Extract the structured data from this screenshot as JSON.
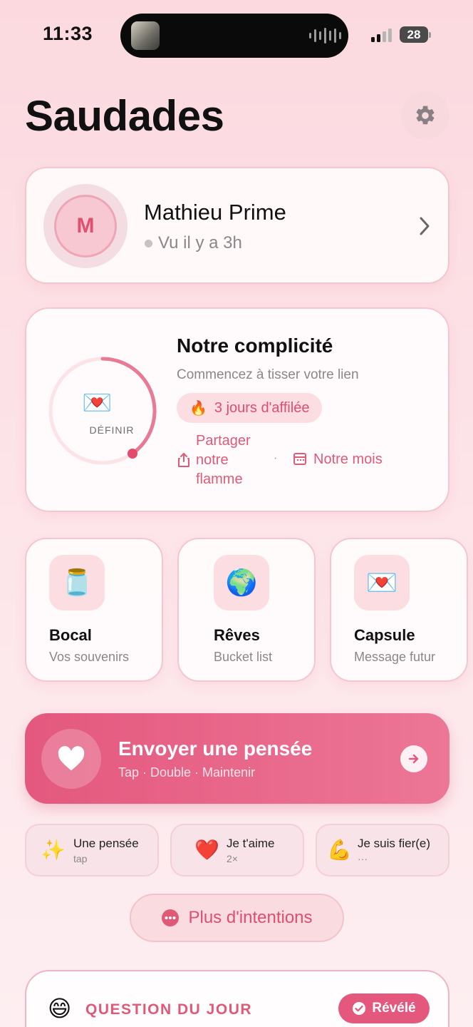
{
  "status_bar": {
    "time": "11:33",
    "battery": "28"
  },
  "header": {
    "title": "Saudades",
    "settings_icon": "gear-icon"
  },
  "profile": {
    "initial": "M",
    "name": "Mathieu Prime",
    "last_seen": "Vu il y a 3h"
  },
  "complicity": {
    "ring_label": "DÉFINIR",
    "ring_icon": "💌",
    "title": "Notre complicité",
    "subtitle": "Commencez à tisser votre lien",
    "streak_icon": "🔥",
    "streak": "3 jours d'affilée",
    "share": "Partager notre flamme",
    "separator": "·",
    "month": "Notre mois",
    "accent": "#e0597a"
  },
  "tiles": [
    {
      "icon": "🫙",
      "name": "Bocal",
      "sub": "Vos souvenirs"
    },
    {
      "icon": "🌍",
      "name": "Rêves",
      "sub": "Bucket list"
    },
    {
      "icon": "💌",
      "name": "Capsule",
      "sub": "Message futur"
    }
  ],
  "send": {
    "title": "Envoyer une pensée",
    "subtitle": "Tap · Double · Maintenir"
  },
  "chips": [
    {
      "icon": "✨",
      "title": "Une pensée",
      "sub": "tap"
    },
    {
      "icon": "❤️",
      "title": "Je t'aime",
      "sub": "2×"
    },
    {
      "icon": "💪",
      "title": "Je suis fier(e)",
      "sub": "···"
    }
  ],
  "more": {
    "label": "Plus d'intentions"
  },
  "question": {
    "emoji": "😄",
    "title": "QUESTION DU JOUR",
    "badge": "Révélé"
  }
}
